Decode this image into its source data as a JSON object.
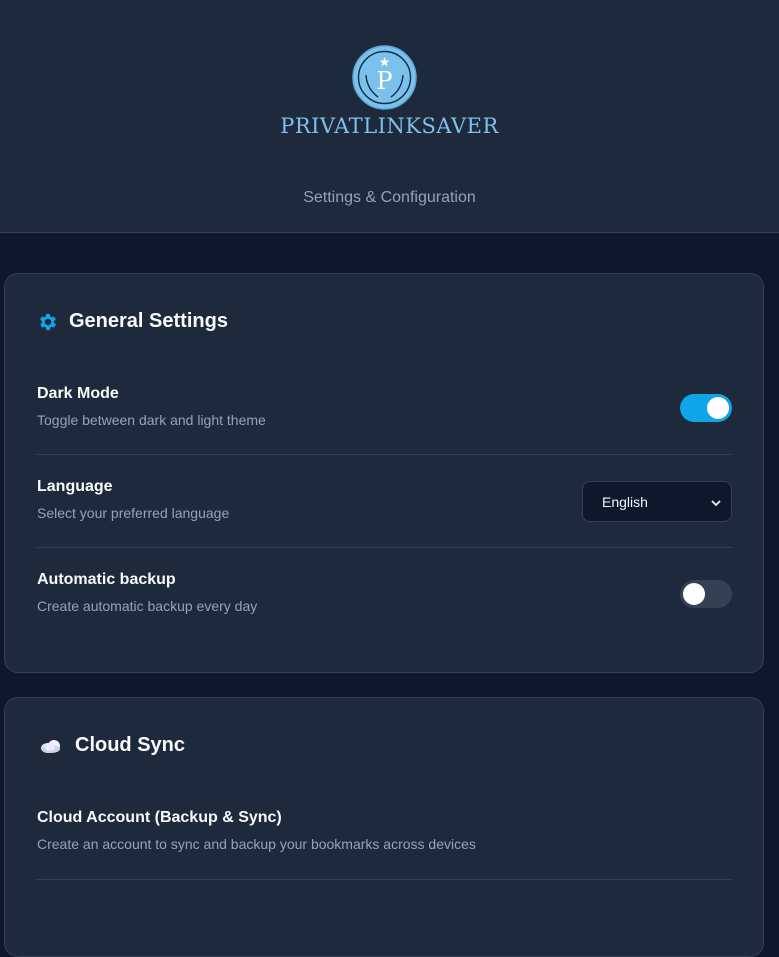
{
  "header": {
    "brand": "PRIVATLINKSAVER",
    "logo_letter": "P",
    "subtitle": "Settings & Configuration"
  },
  "general": {
    "title": "General Settings",
    "icon": "gear-icon",
    "dark_mode": {
      "label": "Dark Mode",
      "description": "Toggle between dark and light theme",
      "enabled": true
    },
    "language": {
      "label": "Language",
      "description": "Select your preferred language",
      "selected": "English"
    },
    "backup": {
      "label": "Automatic backup",
      "description": "Create automatic backup every day",
      "enabled": false
    }
  },
  "cloud": {
    "title": "Cloud Sync",
    "icon": "cloud-icon",
    "account": {
      "label": "Cloud Account (Backup & Sync)",
      "description": "Create an account to sync and backup your bookmarks across devices"
    }
  },
  "colors": {
    "accent": "#0ea5e9",
    "background": "#0f172a",
    "card": "#1e293b",
    "brand": "#7cc1ec"
  }
}
